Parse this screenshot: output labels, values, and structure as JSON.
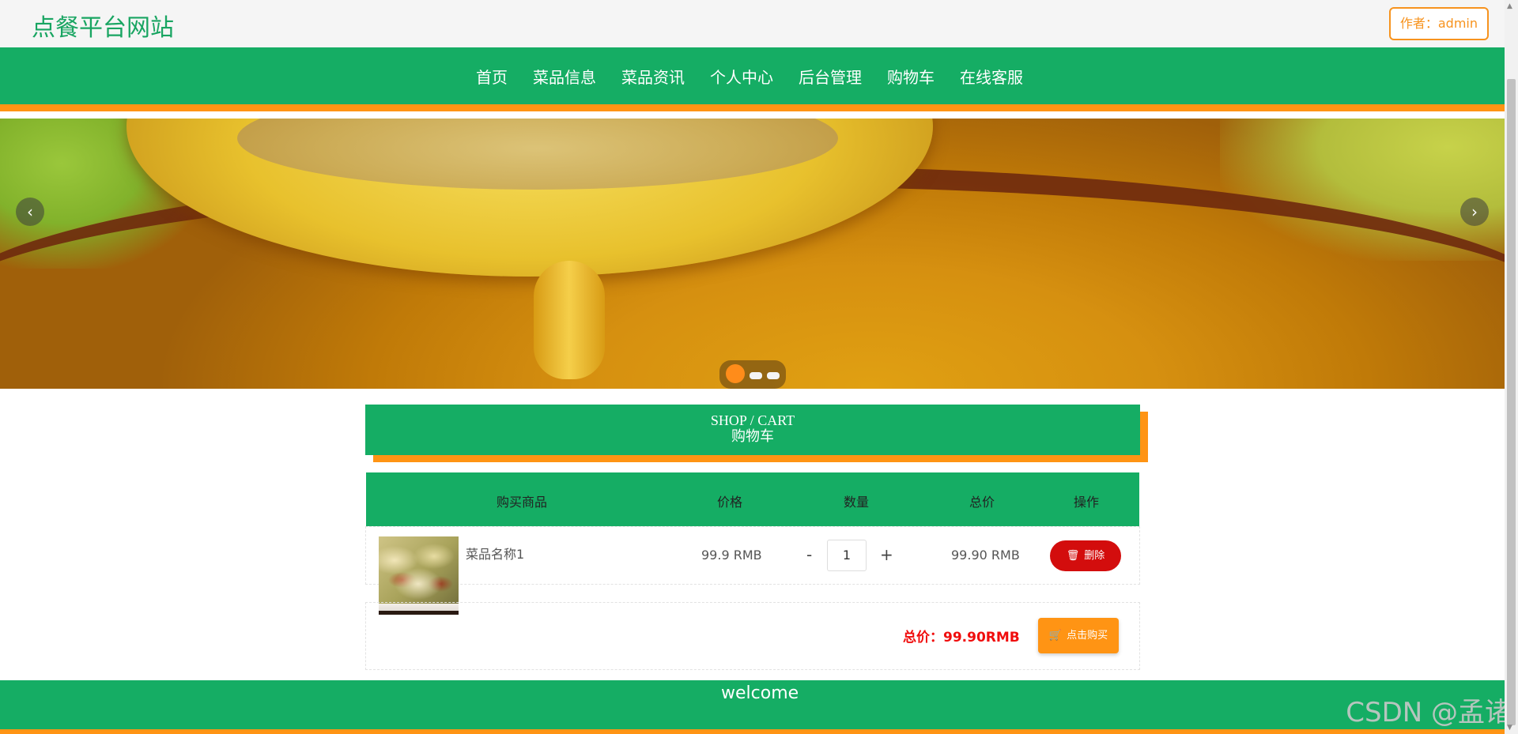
{
  "header": {
    "brand": "点餐平台网站",
    "author_button": "作者：admin"
  },
  "nav": {
    "items": [
      "首页",
      "菜品信息",
      "菜品资讯",
      "个人中心",
      "后台管理",
      "购物车",
      "在线客服"
    ]
  },
  "carousel": {
    "prev_icon": "chevron-left-icon",
    "next_icon": "chevron-right-icon",
    "slide_count": 3,
    "active_slide": 1
  },
  "section": {
    "title_en": "SHOP / CART",
    "title_cn": "购物车"
  },
  "cart": {
    "columns": [
      "购买商品",
      "价格",
      "数量",
      "总价",
      "操作"
    ],
    "items": [
      {
        "name": "菜品名称1",
        "price": "99.9 RMB",
        "quantity": "1",
        "minus": "-",
        "plus": "+",
        "subtotal": "99.90 RMB",
        "delete_label": "删除"
      }
    ],
    "total_label": "总价：99.90RMB",
    "buy_label": "点击购买"
  },
  "footer": {
    "welcome": "welcome"
  },
  "watermark": "CSDN @孟诸",
  "colors": {
    "primary_green": "#15ad64",
    "accent_orange": "#ff9414",
    "delete_red": "#d30d0d",
    "total_red": "#f00d0d"
  }
}
